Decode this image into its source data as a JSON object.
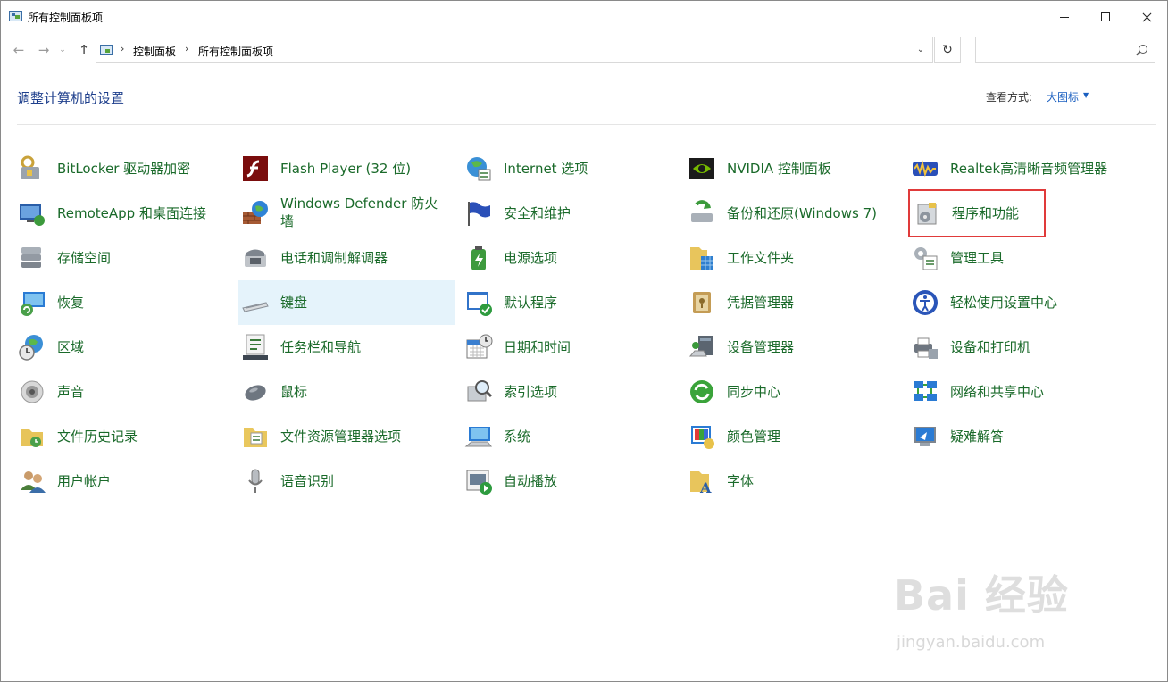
{
  "window": {
    "title": "所有控制面板项"
  },
  "nav": {
    "breadcrumb": [
      "控制面板",
      "所有控制面板项"
    ],
    "search_placeholder": ""
  },
  "header": {
    "title": "调整计算机的设置",
    "view_by_label": "查看方式:",
    "view_by_value": "大图标"
  },
  "columns": [
    [
      {
        "label": "BitLocker 驱动器加密",
        "icon": "bitlocker-icon"
      },
      {
        "label": "RemoteApp 和桌面连接",
        "icon": "remoteapp-icon"
      },
      {
        "label": "存储空间",
        "icon": "storage-spaces-icon"
      },
      {
        "label": "恢复",
        "icon": "recovery-icon"
      },
      {
        "label": "区域",
        "icon": "region-icon"
      },
      {
        "label": "声音",
        "icon": "sound-icon"
      },
      {
        "label": "文件历史记录",
        "icon": "file-history-icon"
      },
      {
        "label": "用户帐户",
        "icon": "user-accounts-icon"
      }
    ],
    [
      {
        "label": "Flash Player (32 位)",
        "icon": "flash-icon"
      },
      {
        "label": "Windows Defender 防火墙",
        "icon": "firewall-icon"
      },
      {
        "label": "电话和调制解调器",
        "icon": "phone-modem-icon"
      },
      {
        "label": "键盘",
        "icon": "keyboard-icon"
      },
      {
        "label": "任务栏和导航",
        "icon": "taskbar-icon"
      },
      {
        "label": "鼠标",
        "icon": "mouse-icon"
      },
      {
        "label": "文件资源管理器选项",
        "icon": "folder-options-icon"
      },
      {
        "label": "语音识别",
        "icon": "microphone-icon"
      }
    ],
    [
      {
        "label": "Internet 选项",
        "icon": "internet-options-icon"
      },
      {
        "label": "安全和维护",
        "icon": "security-flag-icon"
      },
      {
        "label": "电源选项",
        "icon": "power-options-icon"
      },
      {
        "label": "默认程序",
        "icon": "default-programs-icon"
      },
      {
        "label": "日期和时间",
        "icon": "date-time-icon"
      },
      {
        "label": "索引选项",
        "icon": "indexing-icon"
      },
      {
        "label": "系统",
        "icon": "system-icon"
      },
      {
        "label": "自动播放",
        "icon": "autoplay-icon"
      }
    ],
    [
      {
        "label": "NVIDIA 控制面板",
        "icon": "nvidia-icon"
      },
      {
        "label": "备份和还原(Windows 7)",
        "icon": "backup-icon"
      },
      {
        "label": "工作文件夹",
        "icon": "work-folders-icon"
      },
      {
        "label": "凭据管理器",
        "icon": "credential-icon"
      },
      {
        "label": "设备管理器",
        "icon": "device-manager-icon"
      },
      {
        "label": "同步中心",
        "icon": "sync-icon"
      },
      {
        "label": "颜色管理",
        "icon": "color-icon"
      },
      {
        "label": "字体",
        "icon": "fonts-icon"
      }
    ],
    [
      {
        "label": "Realtek高清晰音频管理器",
        "icon": "realtek-icon"
      },
      {
        "label": "程序和功能",
        "icon": "programs-icon"
      },
      {
        "label": "管理工具",
        "icon": "admin-tools-icon"
      },
      {
        "label": "轻松使用设置中心",
        "icon": "ease-of-access-icon"
      },
      {
        "label": "设备和打印机",
        "icon": "printer-icon"
      },
      {
        "label": "网络和共享中心",
        "icon": "network-icon"
      },
      {
        "label": "疑难解答",
        "icon": "troubleshoot-icon"
      }
    ]
  ],
  "watermark": {
    "main": "Bai 经验",
    "sub": "jingyan.baidu.com"
  }
}
